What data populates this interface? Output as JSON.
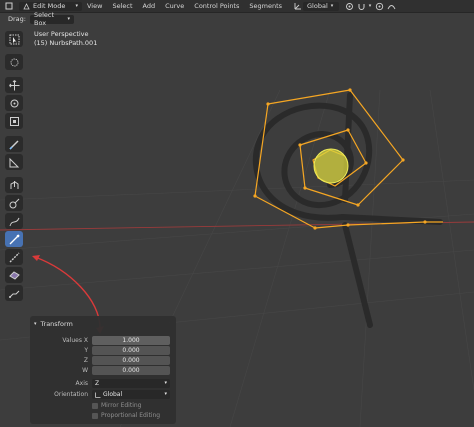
{
  "header": {
    "mode": "Edit Mode",
    "menu": [
      "View",
      "Select",
      "Add",
      "Curve",
      "Control Points",
      "Segments"
    ],
    "transform_orientation": "Global"
  },
  "subheader": {
    "drag_label": "Drag:",
    "drag_value": "Select Box"
  },
  "viewport": {
    "perspective": "User Perspective",
    "object": "(15) NurbsPath.001"
  },
  "toolbar": {
    "tools": [
      "select-box",
      "cursor",
      "move",
      "rotate",
      "scale",
      "annotate",
      "measure",
      "extrude",
      "radius",
      "draw",
      "curve-pen",
      "tilt",
      "randomize",
      "shear"
    ],
    "active": "curve-pen"
  },
  "panel": {
    "title": "Transform",
    "values_label": "Values X",
    "y_label": "Y",
    "z_label": "Z",
    "w_label": "W",
    "values": [
      "1.000",
      "0.000",
      "0.000",
      "0.000"
    ],
    "axis_label": "Axis",
    "axis_value": "Z",
    "orientation_label": "Orientation",
    "orientation_value": "Global",
    "mirror_label": "Mirror Editing",
    "proportional_label": "Proportional Editing"
  },
  "colors": {
    "curve": "#f5a623",
    "path": "#2a2a2a",
    "active_tool": "#4772b3",
    "annotation": "#d93a3a"
  }
}
